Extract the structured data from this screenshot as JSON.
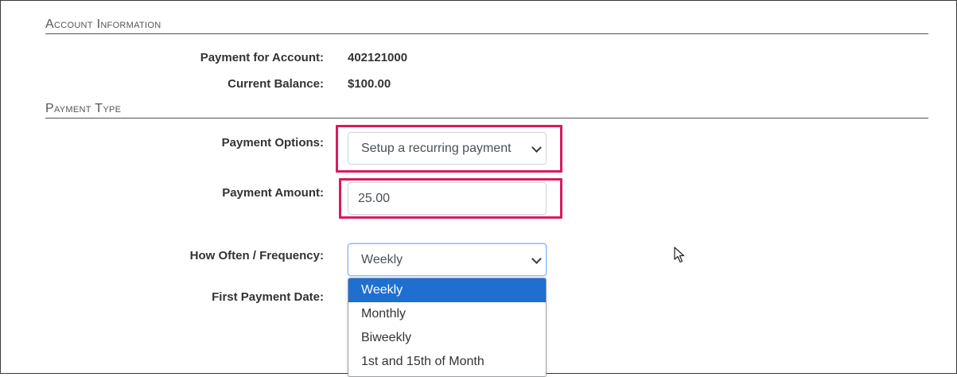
{
  "sections": {
    "account_info": "Account Information",
    "payment_type": "Payment Type"
  },
  "account": {
    "payment_for_label": "Payment for Account:",
    "payment_for_value": "402121000",
    "balance_label": "Current Balance:",
    "balance_value": "$100.00"
  },
  "form": {
    "options_label": "Payment Options:",
    "options_value": "Setup a recurring payment",
    "amount_label": "Payment Amount:",
    "amount_value": "25.00",
    "frequency_label": "How Often / Frequency:",
    "frequency_value": "Weekly",
    "first_date_label": "First Payment Date:"
  },
  "frequency_options": [
    "Weekly",
    "Monthly",
    "Biweekly",
    "1st and 15th of Month"
  ],
  "colors": {
    "highlight": "#d81b60",
    "selected_option": "#1f6fd1"
  }
}
